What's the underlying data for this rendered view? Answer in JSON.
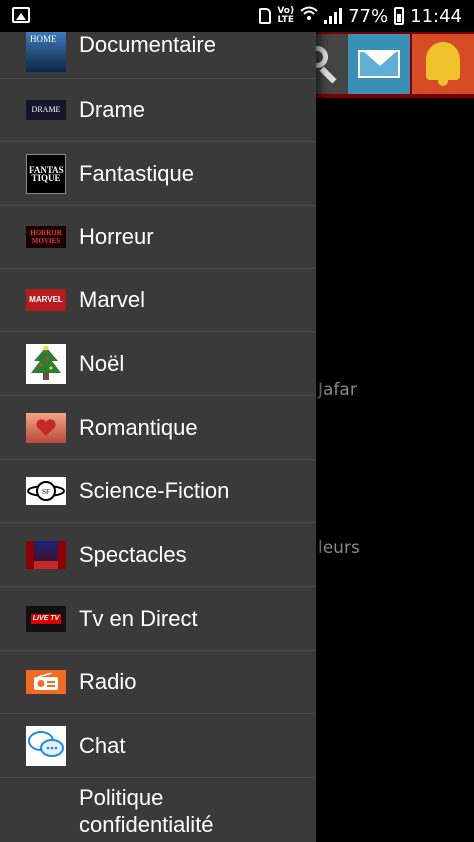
{
  "status_bar": {
    "volte": "Vo)\nLTE",
    "battery_percent": "77%",
    "time": "11:44"
  },
  "background": {
    "label_jafar": "Jafar",
    "label_leurs": "leurs"
  },
  "drawer": {
    "items": [
      {
        "label": "Documentaire",
        "thumb_text": "HOME",
        "thumb_bg": "#2b5c8a"
      },
      {
        "label": "Drame",
        "thumb_text": "DRAME",
        "thumb_bg": "#1a1a2e"
      },
      {
        "label": "Fantastique",
        "thumb_text": "FANTAS TIQUE",
        "thumb_bg": "#000000"
      },
      {
        "label": "Horreur",
        "thumb_text": "HORROR MOVIES",
        "thumb_bg": "#1a0000"
      },
      {
        "label": "Marvel",
        "thumb_text": "MARVEL",
        "thumb_bg": "#b71c1c"
      },
      {
        "label": "Noël",
        "thumb_text": "",
        "thumb_bg": "#ffffff"
      },
      {
        "label": "Romantique",
        "thumb_text": "",
        "thumb_bg": "#c0563a"
      },
      {
        "label": "Science-Fiction",
        "thumb_text": "SF",
        "thumb_bg": "#ffffff"
      },
      {
        "label": "Spectacles",
        "thumb_text": "",
        "thumb_bg": "#5a0a0a"
      },
      {
        "label": "Tv en Direct",
        "thumb_text": "LIVE TV",
        "thumb_bg": "#111111"
      },
      {
        "label": "Radio",
        "thumb_text": "",
        "thumb_bg": "#f26b21"
      },
      {
        "label": "Chat",
        "thumb_text": "",
        "thumb_bg": "#ffffff"
      },
      {
        "label": "Politique confidentialité",
        "thumb_text": "",
        "thumb_bg": ""
      }
    ]
  }
}
